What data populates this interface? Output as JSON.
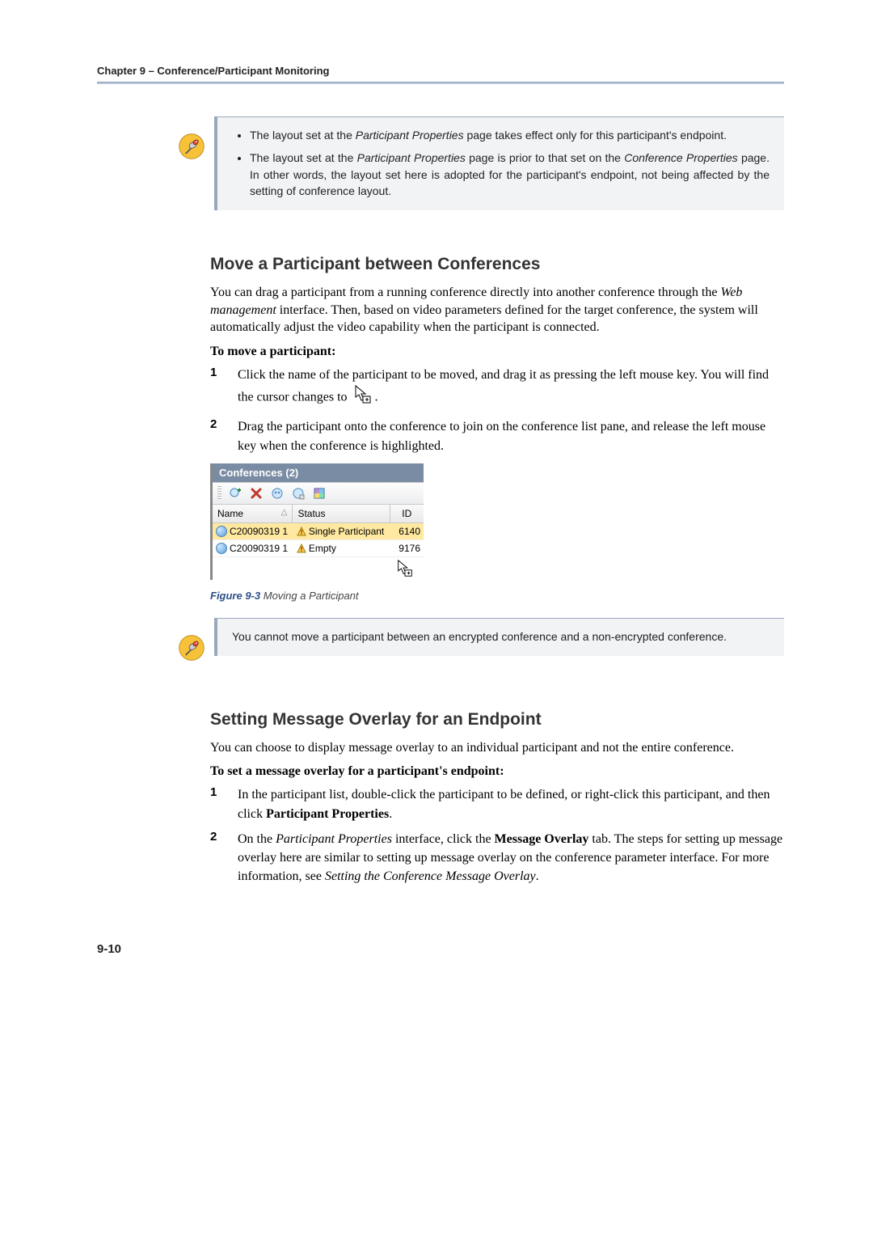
{
  "header": {
    "line": "Chapter 9 – Conference/Participant Monitoring"
  },
  "note1": {
    "item1_a": "The layout set at the ",
    "item1_b": "Participant Properties",
    "item1_c": " page takes effect only for this participant's endpoint.",
    "item2_a": "The layout set at the ",
    "item2_b": "Participant Properties",
    "item2_c": " page is prior to that set on the ",
    "item2_d": "Conference Properties",
    "item2_e": " page. In other words, the layout set here is adopted for the participant's endpoint, not being affected by the setting of conference layout."
  },
  "sect1": {
    "title": "Move a Participant between Conferences",
    "para_a": "You can drag a participant from a running conference directly into another conference through the ",
    "para_b": "Web management",
    "para_c": " interface. Then, based on video parameters defined for the target conference, the system will automatically adjust the video capability when the participant is connected.",
    "subhead": "To move a participant:",
    "step1_a": "Click the name of the participant to be moved, and drag it as pressing the left mouse key. You will find the cursor changes to ",
    "step1_b": ".",
    "step2": "Drag the participant onto the conference to join on the conference list pane, and release the left mouse key when the conference is highlighted."
  },
  "figure": {
    "panel_title": "Conferences (2)",
    "col_name": "Name",
    "col_status": "Status",
    "col_id": "ID",
    "row1_name": "C20090319 1",
    "row1_status": "Single Participant",
    "row1_id": "6140",
    "row2_name": "C20090319 1",
    "row2_status": "Empty",
    "row2_id": "9176",
    "caption_label": "Figure 9-3",
    "caption_text": " Moving a Participant"
  },
  "note2": {
    "text": "You cannot move a participant between an encrypted conference and a non-encrypted conference."
  },
  "sect2": {
    "title": "Setting Message Overlay for an Endpoint",
    "para": "You can choose to display message overlay to an individual participant and not the entire conference.",
    "subhead": "To set a message overlay for a participant's endpoint:",
    "step1_a": "In the participant list, double-click the participant to be defined, or right-click this participant, and then click ",
    "step1_b": "Participant Properties",
    "step1_c": ".",
    "step2_a": "On the ",
    "step2_b": "Participant Properties",
    "step2_c": " interface, click the ",
    "step2_d": "Message Overlay",
    "step2_e": " tab. The steps for setting up message overlay here are similar to setting up message overlay on the conference parameter interface. For more information, see ",
    "step2_f": "Setting the Conference Message Overlay",
    "step2_g": "."
  },
  "footer": {
    "pagenum": "9-10"
  }
}
